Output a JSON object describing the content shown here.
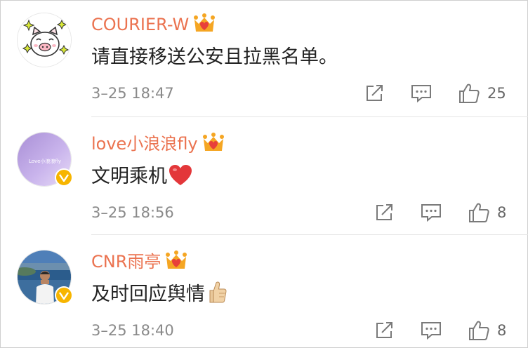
{
  "colors": {
    "username": "#eb7350",
    "verified": "#f7b500",
    "text": "#222222",
    "meta": "#8a8a8a"
  },
  "comments": [
    {
      "username": "COURIER-W",
      "text": "请直接移送公安且拉黑名单。",
      "emoji": "",
      "time": "3–25 18:47",
      "likes": "25",
      "avatar_icon": "pig-avatar-icon",
      "avatar_text": "",
      "verified": false
    },
    {
      "username": "love小浪浪fly",
      "text": "文明乘机",
      "emoji": "red-heart-icon",
      "time": "3–25 18:56",
      "likes": "8",
      "avatar_icon": "purple-sky-avatar-icon",
      "avatar_text": "Love小浪浪fly",
      "verified": true
    },
    {
      "username": "CNR雨亭",
      "text": "及时回应舆情",
      "emoji": "thumbs-up-emoji-icon",
      "time": "3–25 18:40",
      "likes": "8",
      "avatar_icon": "person-by-sea-avatar-icon",
      "avatar_text": "",
      "verified": true
    }
  ]
}
